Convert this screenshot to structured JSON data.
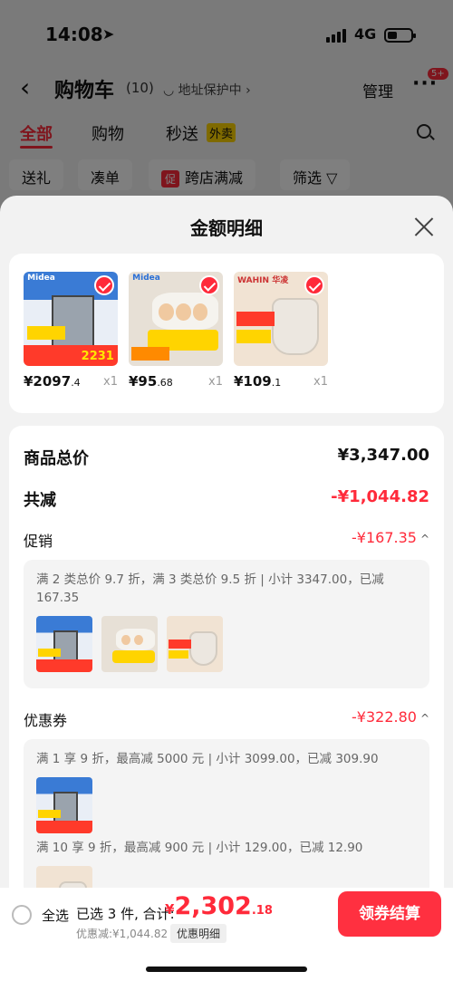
{
  "status": {
    "time": "14:08",
    "network": "4G"
  },
  "nav": {
    "back": "‹",
    "title": "购物车",
    "count": "(10)",
    "address": "◡ 地址保护中 ›",
    "manage": "管理",
    "more": "···",
    "badge": "5+"
  },
  "tabs": [
    {
      "label": "全部"
    },
    {
      "label": "购物"
    },
    {
      "label": "秒送"
    }
  ],
  "tab_tag": "外卖",
  "chips": [
    {
      "label": "送礼"
    },
    {
      "label": "凑单"
    },
    {
      "label": "跨店满减",
      "tag": "促"
    },
    {
      "label": "筛选 ▽"
    }
  ],
  "sheet": {
    "title": "金额明细",
    "products": [
      {
        "price_int": "¥2097",
        "price_dec": ".4",
        "qty": "x1",
        "brand": "Midea",
        "promo_price": "2231"
      },
      {
        "price_int": "¥95",
        "price_dec": ".68",
        "qty": "x1",
        "brand": "Midea"
      },
      {
        "price_int": "¥109",
        "price_dec": ".1",
        "qty": "x1",
        "brand": "WAHIN 华凌"
      }
    ],
    "total_label": "商品总价",
    "total_value": "¥3,347.00",
    "reduce_label": "共减",
    "reduce_value": "-¥1,044.82",
    "promo_label": "促销",
    "promo_value": "-¥167.35",
    "promo_text": "满 2 类总价 9.7 折，满 3 类总价 9.5 折 | 小计 3347.00，已减 167.35",
    "coupon_label": "优惠券",
    "coupon_value": "-¥322.80",
    "coupon_text_1": "满 1 享 9 折，最高减 5000 元 | 小计 3099.00，已减 309.90",
    "coupon_text_2": "满 10 享 9 折，最高减 900 元 | 小计 129.00，已减 12.90"
  },
  "bottom": {
    "select_all": "全选",
    "selected": "已选 3 件, 合计:",
    "currency": "¥",
    "total_int": "2,302",
    "total_dec": ".18",
    "discount": "优惠减:¥1,044.82",
    "detail": "优惠明细",
    "checkout": "领券结算"
  },
  "colors": {
    "accent": "#ff2a3a",
    "sheet_bg": "#f2f2f2",
    "checkout_bg": "#ff3040"
  }
}
